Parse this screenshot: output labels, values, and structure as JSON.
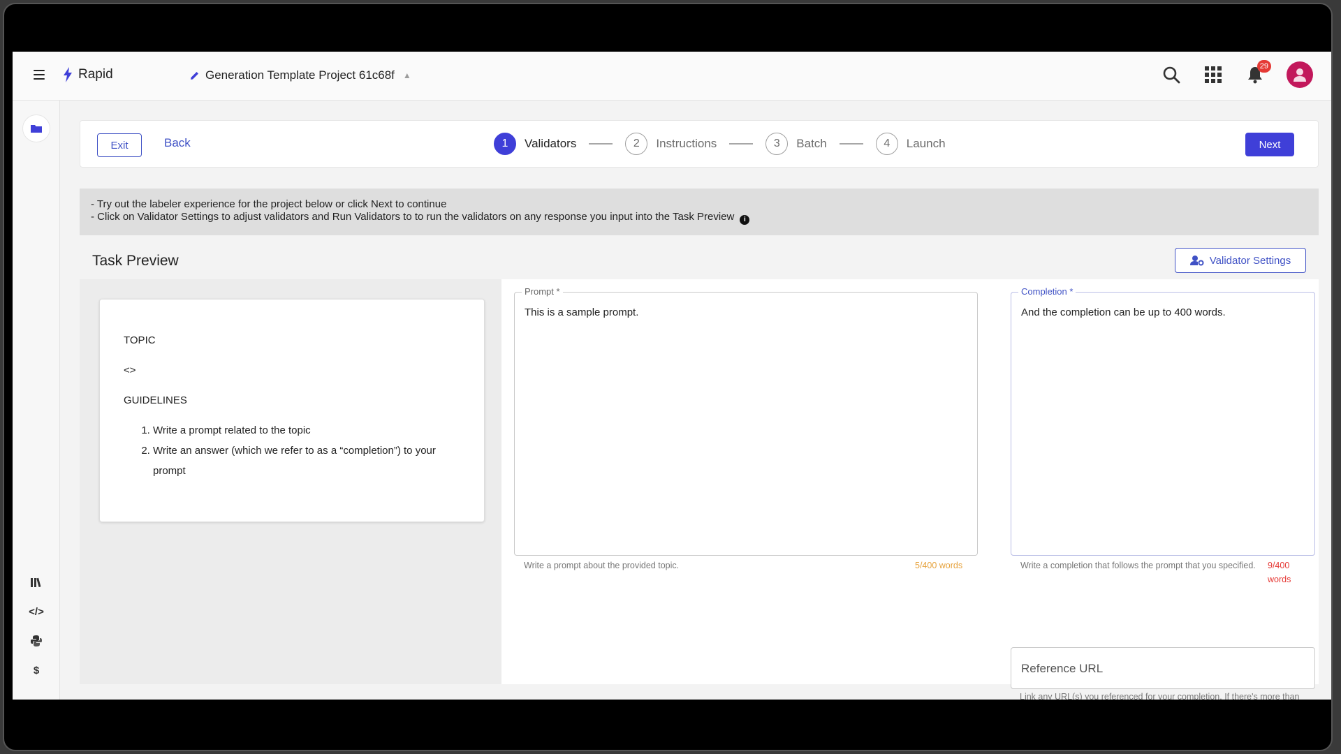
{
  "header": {
    "brand": "Rapid",
    "project_title": "Generation Template Project 61c68f",
    "notification_count": "29"
  },
  "stepbar": {
    "exit_label": "Exit",
    "back_label": "Back",
    "steps": [
      {
        "num": "1",
        "label": "Validators",
        "active": true
      },
      {
        "num": "2",
        "label": "Instructions",
        "active": false
      },
      {
        "num": "3",
        "label": "Batch",
        "active": false
      },
      {
        "num": "4",
        "label": "Launch",
        "active": false
      }
    ],
    "next_label": "Next"
  },
  "info": {
    "line1": "- Try out the labeler experience for the project below or click Next to continue",
    "line2": "- Click on Validator Settings to adjust validators and Run Validators to to run the validators on any response you input into the Task Preview"
  },
  "task_preview": {
    "title": "Task Preview",
    "validator_settings_label": "Validator Settings"
  },
  "instructions": {
    "topic_heading": "TOPIC",
    "topic_value": "<>",
    "guidelines_heading": "GUIDELINES",
    "items": [
      "Write a prompt related to the topic",
      "Write an answer (which we refer to as a “completion”) to your prompt"
    ]
  },
  "prompt_field": {
    "label": "Prompt *",
    "value": "This is a sample prompt.",
    "helper": "Write a prompt about the provided topic.",
    "count": "5/400 words"
  },
  "completion_field": {
    "label": "Completion *",
    "value": "And the completion can be up to 400 words.",
    "helper": "Write a completion that follows the prompt that you specified.",
    "count": "9/400 words"
  },
  "reference_field": {
    "placeholder": "Reference URL",
    "helper": "Link any URL(s) you referenced for your completion. If there's more than one, create a comma-separated list of URLs."
  },
  "colors": {
    "accent": "#3f3fd8",
    "outline": "#3f51c5",
    "badge": "#e53935",
    "avatar": "#c2185b"
  }
}
